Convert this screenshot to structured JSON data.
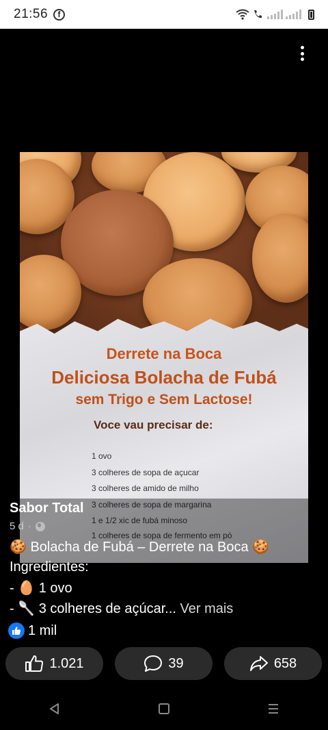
{
  "status_bar": {
    "time": "21:56",
    "app_icon": "facebook-icon"
  },
  "image_overlay": {
    "line1": "Derrete na Boca",
    "line2": "Deliciosa Bolacha de Fubá",
    "line3": "sem Trigo e Sem Lactose!",
    "subheading": "Voce vau precisar de:",
    "ingredients": [
      "1 ovo",
      "3 colheres de sopa de açucar",
      "3 colheres de amido de milho",
      "3 colheres de sopa de margarina",
      "1 e 1/2 xic de fubá minoso",
      "1 colheres de sopa de fermento em pó"
    ]
  },
  "post": {
    "page_name": "Sabor Total",
    "time_ago": "5 d",
    "separator": "·",
    "visibility_icon": "globe-icon",
    "title_emoji": "🍪",
    "title": "Bolacha de Fubá – Derrete na Boca",
    "ingredients_label": "Ingredientes:",
    "line1_prefix": "-",
    "line1_emoji": "🥚",
    "line1_text": "1 ovo",
    "line2_prefix": "-",
    "line2_emoji": "🥄",
    "line2_text": "3 colheres de açúcar...",
    "see_more": "Ver mais"
  },
  "reactions": {
    "icon": "like-icon",
    "count": "1 mil"
  },
  "actions": {
    "like_count": "1.021",
    "comment_count": "39",
    "share_count": "658"
  },
  "colors": {
    "background": "#000000",
    "facebook_blue": "#1877f2",
    "button_bg": "#2b2b2b",
    "overlay_orange": "#c0501a"
  }
}
